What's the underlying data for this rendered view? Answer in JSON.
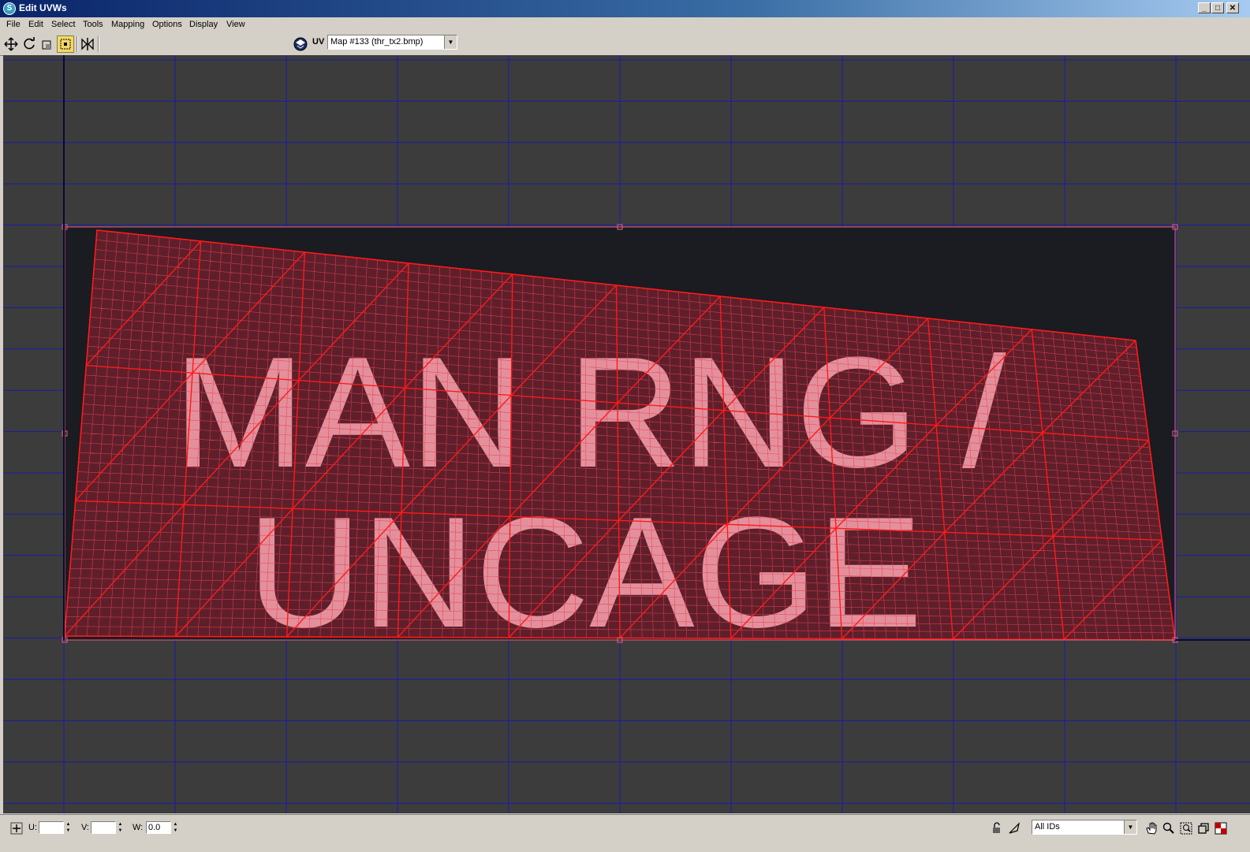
{
  "window": {
    "title": "Edit UVWs",
    "controls": {
      "minimize": "_",
      "maximize": "□",
      "close": "✕"
    }
  },
  "menu": {
    "items": [
      "File",
      "Edit",
      "Select",
      "Tools",
      "Mapping",
      "Options",
      "Display",
      "View"
    ]
  },
  "toolbar": {
    "uv_label": "UV",
    "map_selector": {
      "value": "Map #133 (thr_tx2.bmp)"
    },
    "tools": [
      "move-icon",
      "rotate-icon",
      "scale-icon",
      "freeform-icon",
      "mirror-icon"
    ],
    "active_tool": "freeform-icon"
  },
  "texture": {
    "line1": "MAN RNG /",
    "line2": "UNCAGE"
  },
  "status": {
    "u_label": "U:",
    "u_value": "",
    "v_label": "V:",
    "v_value": "",
    "w_label": "W:",
    "w_value": "0.0",
    "id_filter": "All IDs",
    "right_icons": [
      "lock-icon",
      "paint-icon",
      "pan-hand-icon",
      "zoom-icon",
      "zoom-region-icon",
      "zoom-extents-icon",
      "checker-icon"
    ]
  },
  "colors": {
    "viewport_bg": "#3c3c3c",
    "grid_line": "#1a1aa8",
    "texture_bg": "#1b1b22",
    "texture_text": "#e8c8d0",
    "uv_edge": "#ff1a1a",
    "selection_box": "#e06080"
  }
}
